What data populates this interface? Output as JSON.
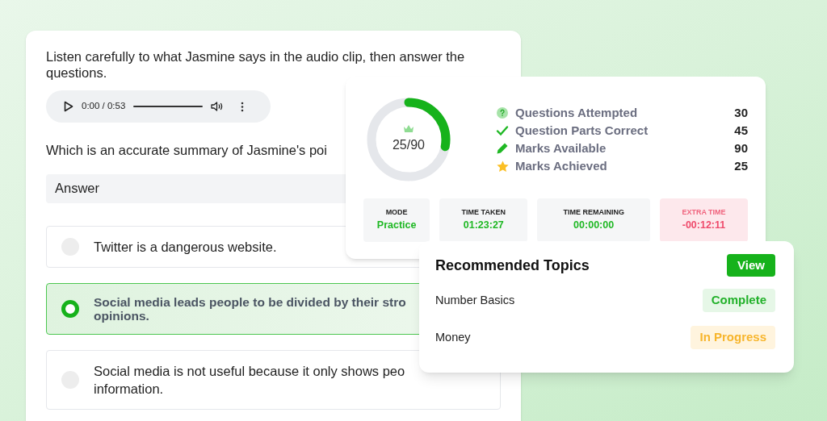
{
  "question_card": {
    "prompt": "Listen carefully to what Jasmine says in the audio clip, then answer the questions.",
    "audio": {
      "time": "0:00 / 0:53"
    },
    "question": "Which is an accurate summary of Jasmine's poi",
    "answer_label": "Answer",
    "options": [
      {
        "lines": [
          "Twitter is a dangerous website."
        ],
        "selected": false
      },
      {
        "lines": [
          "Social media leads people to be divided by their stro",
          "opinions."
        ],
        "selected": true
      },
      {
        "lines": [
          "Social media is not useful because it only shows peo",
          "information."
        ],
        "selected": false
      }
    ]
  },
  "stats_card": {
    "score": {
      "text": "25/90",
      "level": 0.28
    },
    "stats": [
      {
        "kind": "question",
        "label": "Questions Attempted",
        "value": "30"
      },
      {
        "kind": "check",
        "label": "Question Parts Correct",
        "value": "45"
      },
      {
        "kind": "pencil",
        "label": "Marks Available",
        "value": "90"
      },
      {
        "kind": "star",
        "label": "Marks Achieved",
        "value": "25"
      }
    ],
    "tiles": [
      {
        "label": "MODE",
        "value": "Practice",
        "kind": "normal"
      },
      {
        "label": "TIME TAKEN",
        "value": "01:23:27",
        "kind": "normal"
      },
      {
        "label": "TIME REMAINING",
        "value": "00:00:00",
        "kind": "normal"
      },
      {
        "label": "EXTRA TIME",
        "value": "-00:12:11",
        "kind": "warning"
      }
    ]
  },
  "topics_card": {
    "title": "Recommended Topics",
    "button": "View",
    "topics": [
      {
        "name": "Number Basics",
        "status": "Complete",
        "kind": "complete"
      },
      {
        "name": "Money",
        "status": "In Progress",
        "kind": "in_progress"
      }
    ]
  }
}
